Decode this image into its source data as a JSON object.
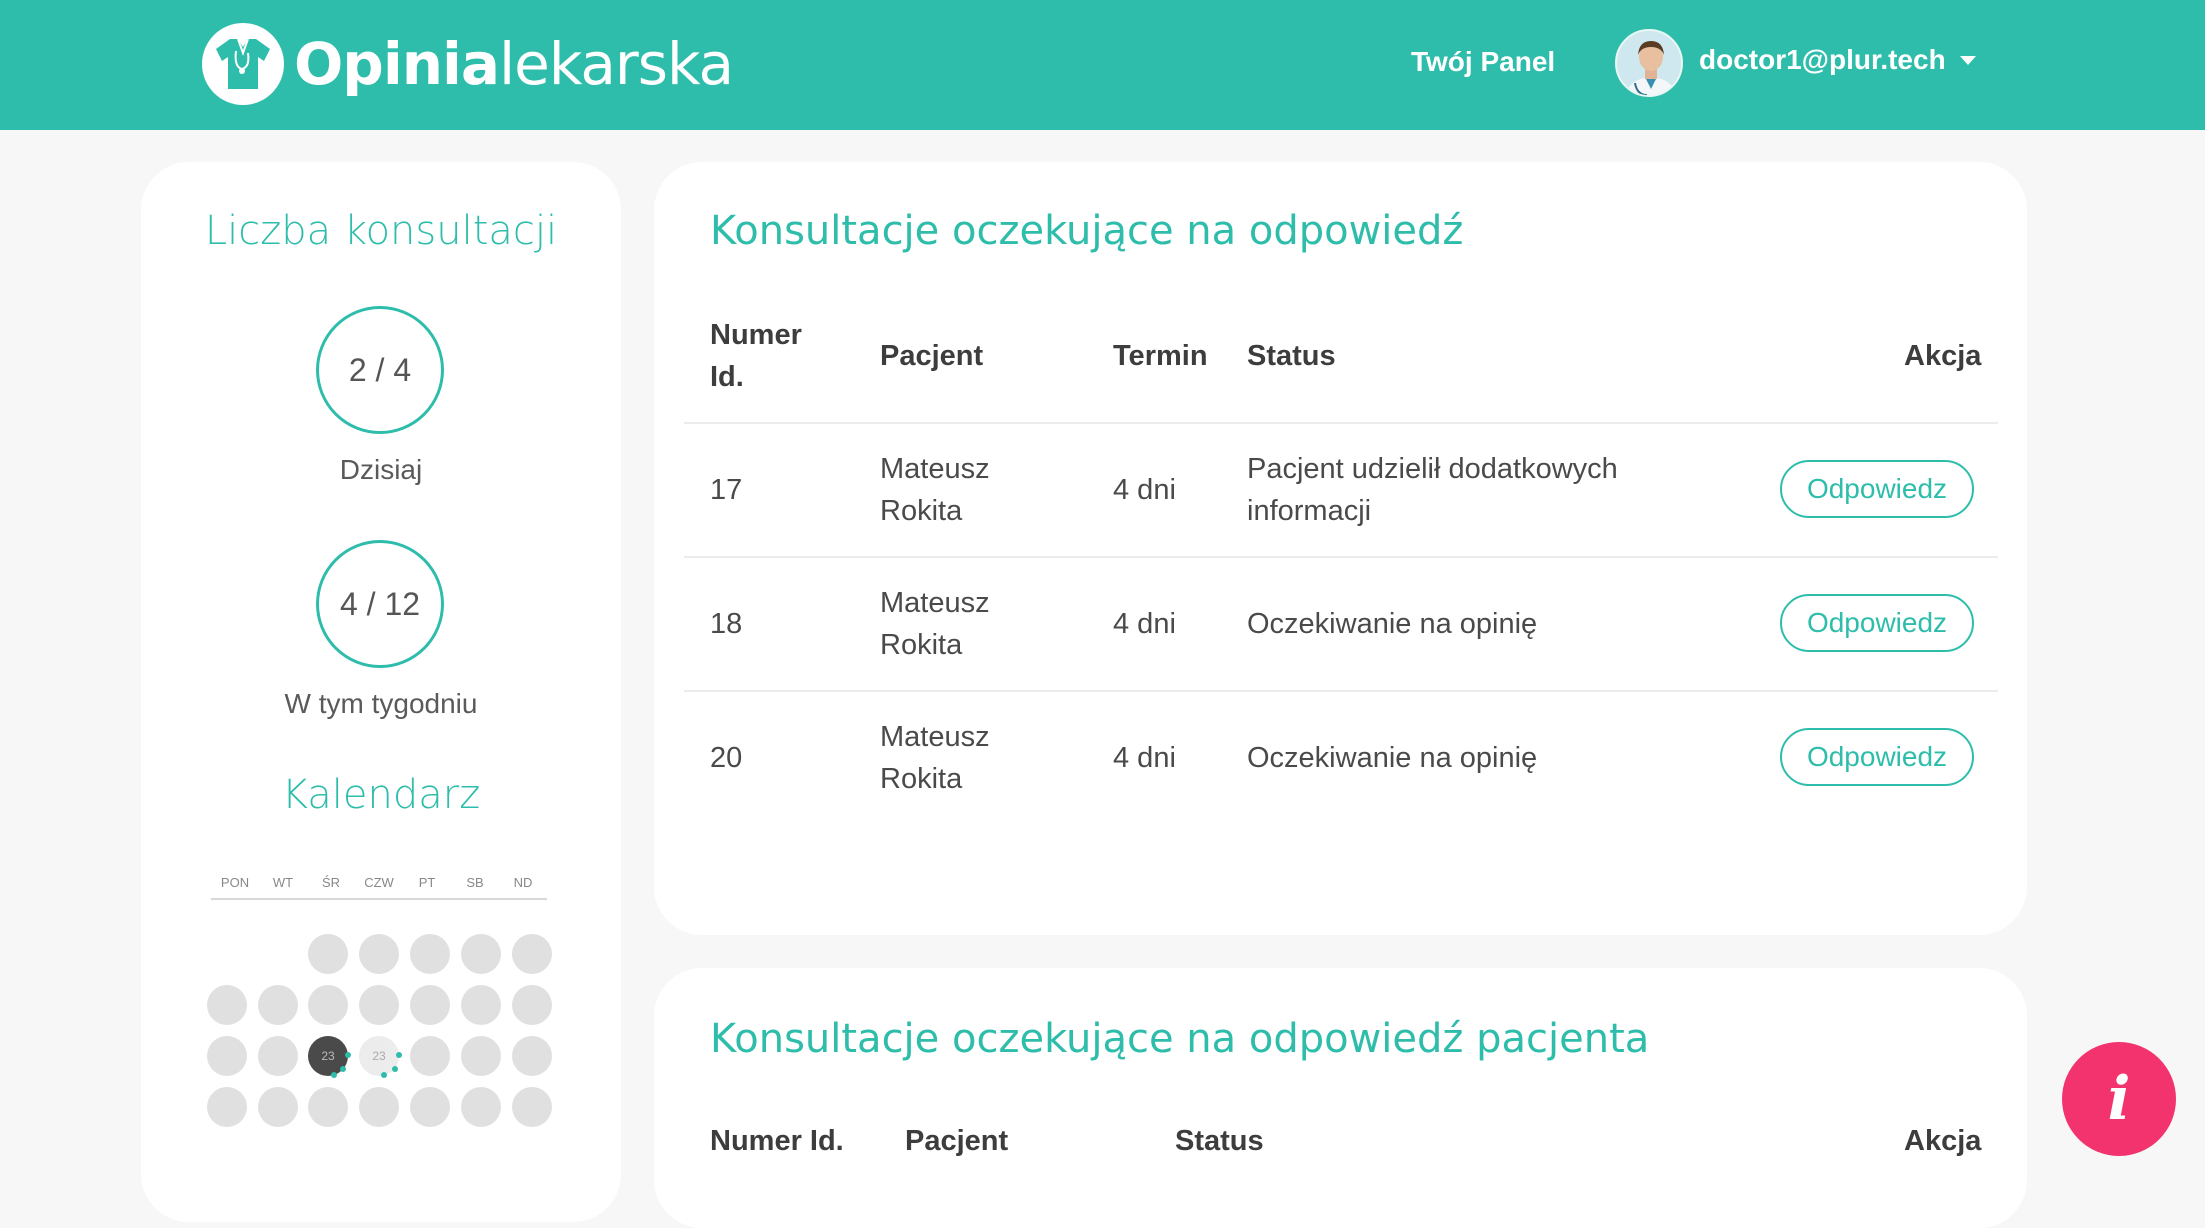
{
  "navbar": {
    "logo_bold": "Opinia",
    "logo_light": "lekarska",
    "panel_link": "Twój Panel",
    "user_email": "doctor1@plur.tech",
    "bg_color": "#2ebdab"
  },
  "sidebar": {
    "consult_title": "Liczba konsultacji",
    "today_count": "2 / 4",
    "today_label": "Dzisiaj",
    "week_count": "4 / 12",
    "week_label": "W tym tygodniu",
    "calendar_title": "Kalendarz",
    "weekdays": [
      "PON",
      "WT",
      "ŚR",
      "CZW",
      "PT",
      "SB",
      "ND"
    ],
    "today_day": "23",
    "next_day": "23"
  },
  "pending": {
    "title": "Konsultacje oczekujące na odpowiedź",
    "headers": {
      "id_line1": "Numer",
      "id_line2": "Id.",
      "patient": "Pacjent",
      "term": "Termin",
      "status": "Status",
      "action": "Akcja"
    },
    "rows": [
      {
        "id": "17",
        "patient_first": "Mateusz",
        "patient_last": "Rokita",
        "term": "4 dni",
        "status_line1": "Pacjent udzielił dodatkowych",
        "status_line2": "informacji",
        "action": "Odpowiedz"
      },
      {
        "id": "18",
        "patient_first": "Mateusz",
        "patient_last": "Rokita",
        "term": "4 dni",
        "status_line1": "Oczekiwanie na opinię",
        "status_line2": "",
        "action": "Odpowiedz"
      },
      {
        "id": "20",
        "patient_first": "Mateusz",
        "patient_last": "Rokita",
        "term": "4 dni",
        "status_line1": "Oczekiwanie na opinię",
        "status_line2": "",
        "action": "Odpowiedz"
      }
    ]
  },
  "patient_pending": {
    "title": "Konsultacje oczekujące na odpowiedź pacjenta",
    "headers": {
      "id": "Numer Id.",
      "patient": "Pacjent",
      "status": "Status",
      "action": "Akcja"
    }
  },
  "fab": {
    "icon": "info-icon",
    "color": "#f2336e"
  }
}
